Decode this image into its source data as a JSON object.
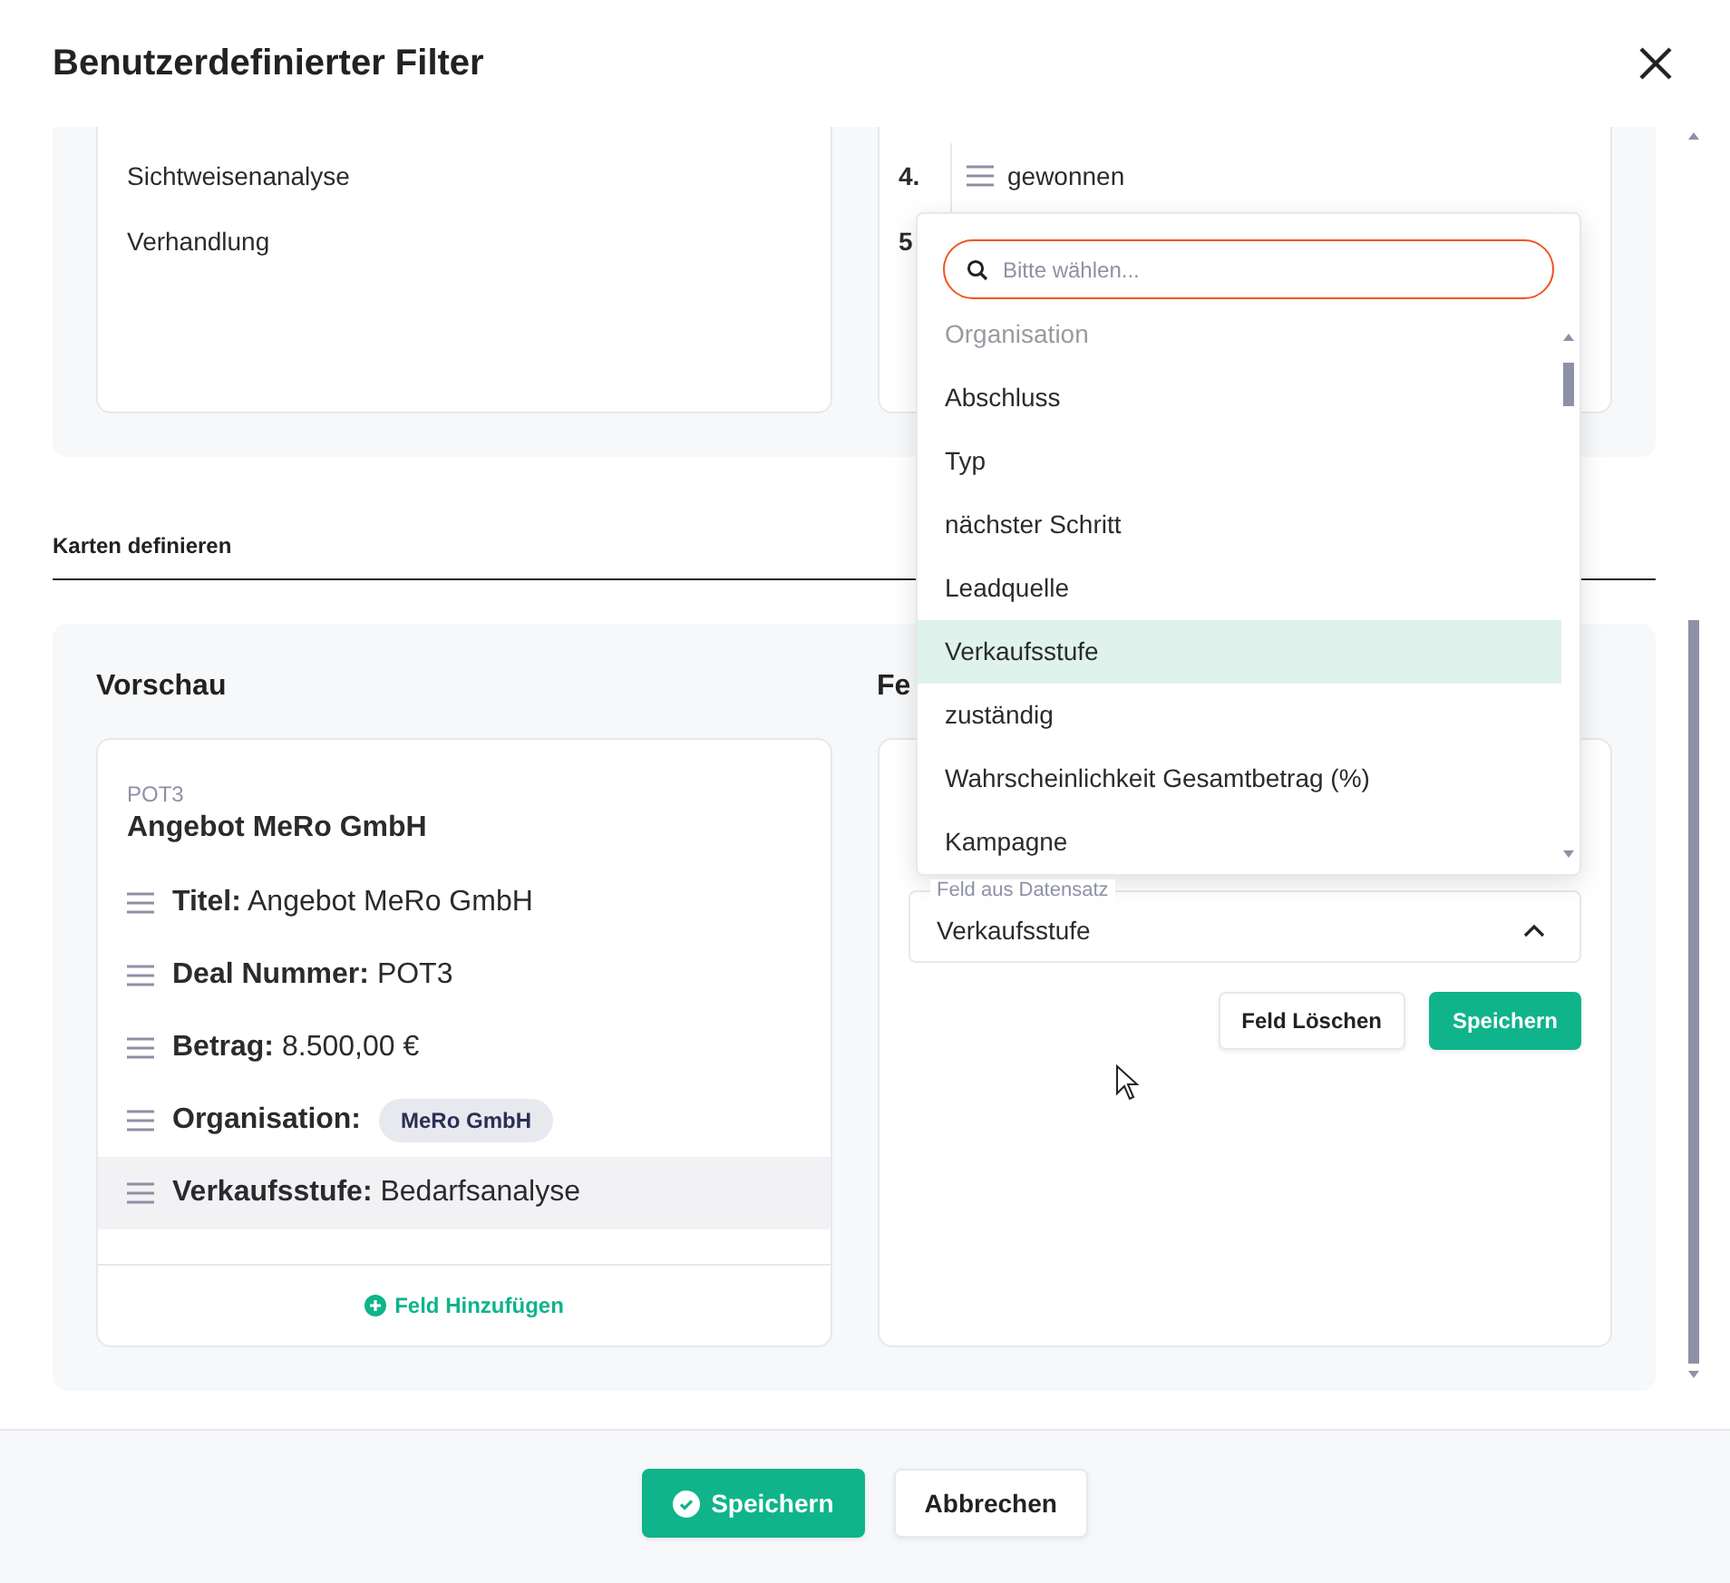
{
  "dialog": {
    "title": "Benutzerdefinierter Filter"
  },
  "stages_panel": {
    "left_items": [
      "Sichtweisenanalyse",
      "Verhandlung"
    ],
    "right_items": [
      {
        "number": "4.",
        "label": "gewonnen"
      },
      {
        "number": "5"
      }
    ]
  },
  "section_title": "Karten definieren",
  "preview": {
    "heading": "Vorschau",
    "code": "POT3",
    "title": "Angebot MeRo GmbH",
    "fields": [
      {
        "label": "Titel:",
        "value": "Angebot MeRo GmbH",
        "kind": "text",
        "selected": false
      },
      {
        "label": "Deal Nummer:",
        "value": "POT3",
        "kind": "text",
        "selected": false
      },
      {
        "label": "Betrag:",
        "value": "8.500,00 €",
        "kind": "text",
        "selected": false
      },
      {
        "label": "Organisation:",
        "value": "MeRo GmbH",
        "kind": "tag",
        "selected": false
      },
      {
        "label": "Verkaufsstufe:",
        "value": "Bedarfsanalyse",
        "kind": "text",
        "selected": true
      }
    ],
    "add_button": "Feld Hinzufügen"
  },
  "field_editor": {
    "heading": "Fe",
    "select": {
      "label": "Feld aus Datensatz",
      "value": "Verkaufsstufe",
      "expanded": true
    },
    "buttons": [
      {
        "label": "Feld Löschen",
        "kind": "secondary"
      },
      {
        "label": "Speichern",
        "kind": "primary"
      }
    ]
  },
  "dropdown": {
    "search": {
      "placeholder": "Bitte wählen..."
    },
    "options": [
      {
        "label": "Organisation",
        "disabled": true,
        "selected": false
      },
      {
        "label": "Abschluss",
        "disabled": false,
        "selected": false
      },
      {
        "label": "Typ",
        "disabled": false,
        "selected": false
      },
      {
        "label": "nächster Schritt",
        "disabled": false,
        "selected": false
      },
      {
        "label": "Leadquelle",
        "disabled": false,
        "selected": false
      },
      {
        "label": "Verkaufsstufe",
        "disabled": false,
        "selected": true
      },
      {
        "label": "zuständig",
        "disabled": false,
        "selected": false
      },
      {
        "label": "Wahrscheinlichkeit Gesamtbetrag (%)",
        "disabled": false,
        "selected": false
      },
      {
        "label": "Kampagne",
        "disabled": false,
        "selected": false
      }
    ]
  },
  "footer": {
    "buttons": [
      {
        "label": "Speichern",
        "kind": "primary"
      },
      {
        "label": "Abbrechen",
        "kind": "secondary"
      }
    ]
  }
}
